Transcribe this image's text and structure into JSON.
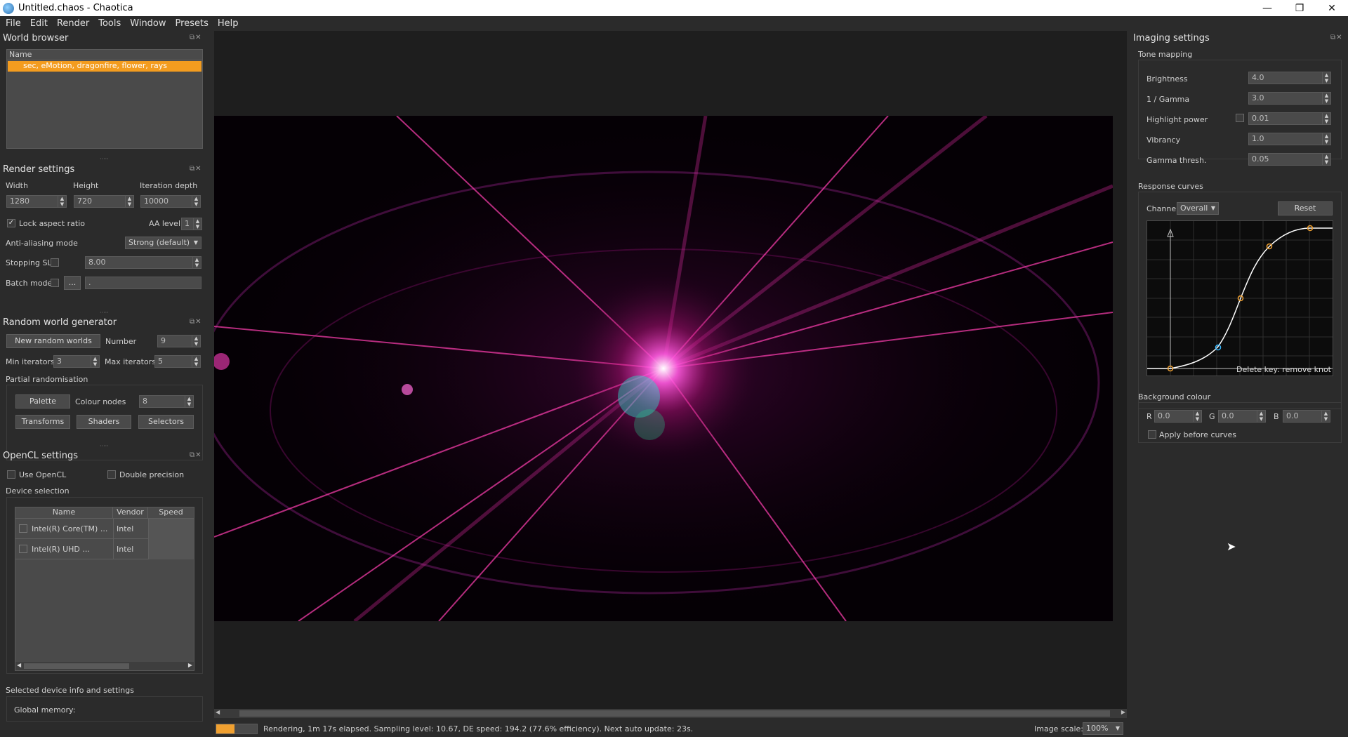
{
  "window": {
    "title": "Untitled.chaos - Chaotica",
    "minimize": "—",
    "maximize": "❐",
    "close": "✕"
  },
  "menu": [
    "File",
    "Edit",
    "Render",
    "Tools",
    "Window",
    "Presets",
    "Help"
  ],
  "world_browser": {
    "title": "World browser",
    "column": "Name",
    "items": [
      "sec, eMotion, dragonfire, flower, rays"
    ]
  },
  "render_settings": {
    "title": "Render settings",
    "width_label": "Width",
    "height_label": "Height",
    "depth_label": "Iteration depth",
    "width": "1280",
    "height": "720",
    "depth": "10000",
    "lock_aspect": "Lock aspect ratio",
    "aa_label": "AA level",
    "aa_value": "1",
    "aa_mode_label": "Anti-aliasing mode",
    "aa_mode_value": "Strong (default)",
    "stopping_label": "Stopping SL",
    "stopping_value": "8.00",
    "batch_label": "Batch mode",
    "batch_btn": "...",
    "batch_value": "."
  },
  "random_gen": {
    "title": "Random world generator",
    "new_btn": "New random worlds",
    "number_label": "Number",
    "number_value": "9",
    "min_label": "Min iterators",
    "min_value": "3",
    "max_label": "Max iterators",
    "max_value": "5",
    "partial_label": "Partial randomisation",
    "palette_btn": "Palette",
    "colour_nodes_label": "Colour nodes",
    "colour_nodes_value": "8",
    "transforms_btn": "Transforms",
    "shaders_btn": "Shaders",
    "selectors_btn": "Selectors"
  },
  "opencl": {
    "title": "OpenCL settings",
    "use_opencl": "Use OpenCL",
    "double_precision": "Double precision",
    "device_selection": "Device selection",
    "columns": [
      "Name",
      "Vendor",
      "Speed"
    ],
    "devices": [
      {
        "name": "Intel(R) Core(TM) ...",
        "vendor": "Intel",
        "speed": ""
      },
      {
        "name": "Intel(R) UHD ...",
        "vendor": "Intel",
        "speed": ""
      }
    ],
    "selected_info": "Selected device info and settings",
    "global_memory": "Global memory:"
  },
  "imaging": {
    "title": "Imaging settings",
    "tone_mapping": "Tone mapping",
    "fields": [
      {
        "label": "Brightness",
        "value": "4.0"
      },
      {
        "label": "1 / Gamma",
        "value": "3.0"
      },
      {
        "label": "Highlight power",
        "value": "0.01"
      },
      {
        "label": "Vibrancy",
        "value": "1.0"
      },
      {
        "label": "Gamma thresh.",
        "value": "0.05"
      }
    ],
    "response_curves": "Response curves",
    "channel_label": "Channel:",
    "channel_value": "Overall",
    "reset_btn": "Reset",
    "curve_hint": "Delete key: remove knot",
    "background_colour": "Background colour",
    "r_label": "R",
    "r_value": "0.0",
    "g_label": "G",
    "g_value": "0.0",
    "b_label": "B",
    "b_value": "0.0",
    "apply_before": "Apply before curves"
  },
  "status": {
    "text": "Rendering, 1m 17s elapsed. Sampling level: 10.67, DE speed: 194.2 (77.6% efficiency). Next auto update: 23s.",
    "scale_label": "Image scale:",
    "scale_value": "100%",
    "progress": 0.45
  },
  "colors": {
    "accent": "#f0a030",
    "selection": "#f39c1f",
    "render_bg": "#050005"
  }
}
